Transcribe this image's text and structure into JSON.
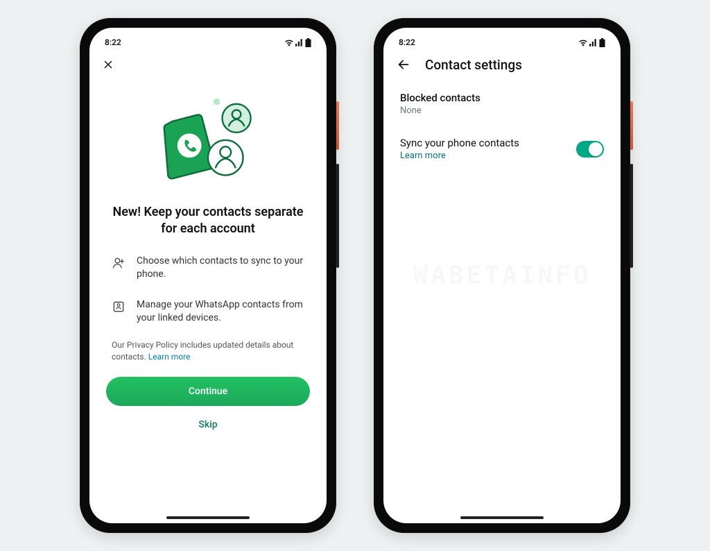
{
  "status": {
    "time": "8:22"
  },
  "phone1": {
    "headline": "New! Keep your contacts separate for each account",
    "feat1": "Choose which contacts to sync to your phone.",
    "feat2": "Manage your WhatsApp contacts from your linked devices.",
    "policy_prefix": "Our Privacy Policy includes updated details about contacts. ",
    "policy_link": "Learn more",
    "cta": "Continue",
    "skip": "Skip"
  },
  "phone2": {
    "appbar_title": "Contact settings",
    "blocked_label": "Blocked contacts",
    "blocked_value": "None",
    "sync_label": "Sync your phone contacts",
    "sync_learn_more": "Learn more",
    "sync_enabled": true
  },
  "colors": {
    "accent": "#00a884",
    "link": "#027eb5"
  }
}
